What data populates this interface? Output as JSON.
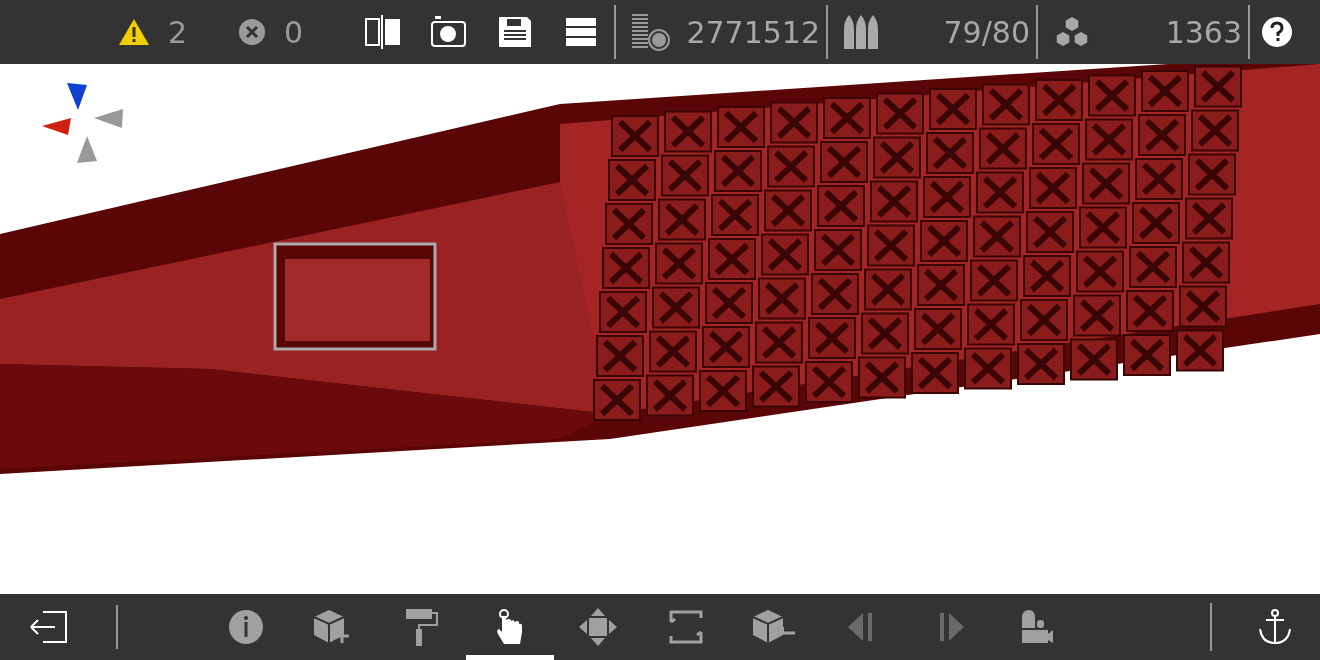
{
  "status": {
    "warnings": "2",
    "errors": "0"
  },
  "stats": [
    {
      "kind": "cost",
      "value": "2771512"
    },
    {
      "kind": "weapons",
      "value": "79/80"
    },
    {
      "kind": "blocks",
      "value": "1363"
    }
  ],
  "tools": [
    {
      "kind": "info",
      "selected": false,
      "disabled": false
    },
    {
      "kind": "add-block",
      "selected": false,
      "disabled": false
    },
    {
      "kind": "paint",
      "selected": false,
      "disabled": false
    },
    {
      "kind": "select",
      "selected": true,
      "disabled": false
    },
    {
      "kind": "move",
      "selected": false,
      "disabled": false
    },
    {
      "kind": "frame",
      "selected": false,
      "disabled": false
    },
    {
      "kind": "remove-block",
      "selected": false,
      "disabled": false
    },
    {
      "kind": "prev",
      "selected": false,
      "disabled": true
    },
    {
      "kind": "next",
      "selected": false,
      "disabled": true
    },
    {
      "kind": "camera",
      "selected": false,
      "disabled": false
    }
  ]
}
